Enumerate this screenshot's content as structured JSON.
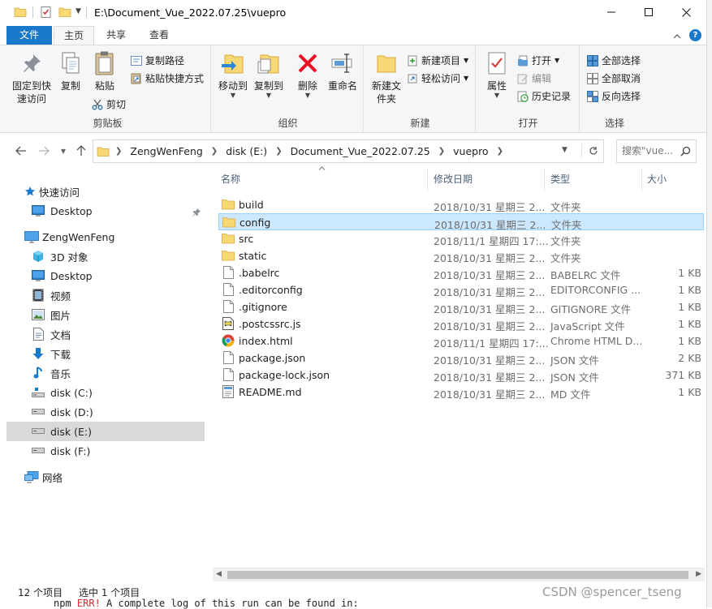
{
  "window": {
    "title": "E:\\Document_Vue_2022.07.25\\vuepro"
  },
  "tabs": [
    {
      "label": "文件"
    },
    {
      "label": "主页"
    },
    {
      "label": "共享"
    },
    {
      "label": "查看"
    }
  ],
  "ribbon": {
    "clipboard": {
      "pin_label": "固定到快速访问",
      "copy_label": "复制",
      "paste_label": "粘贴",
      "copy_path_label": "复制路径",
      "paste_shortcut_label": "粘贴快捷方式",
      "cut_label": "剪切",
      "group_label": "剪贴板"
    },
    "organize": {
      "move_to_label": "移动到",
      "copy_to_label": "复制到",
      "delete_label": "删除",
      "rename_label": "重命名",
      "group_label": "组织"
    },
    "new": {
      "new_folder_label": "新建文件夹",
      "new_item_label": "新建项目",
      "easy_access_label": "轻松访问",
      "group_label": "新建"
    },
    "open": {
      "properties_label": "属性",
      "open_label": "打开",
      "edit_label": "编辑",
      "history_label": "历史记录",
      "group_label": "打开"
    },
    "select": {
      "select_all_label": "全部选择",
      "select_none_label": "全部取消",
      "invert_label": "反向选择",
      "group_label": "选择"
    }
  },
  "address": {
    "crumbs": [
      "ZengWenFeng",
      "disk (E:)",
      "Document_Vue_2022.07.25",
      "vuepro"
    ],
    "search_placeholder": "搜索\"vue..."
  },
  "nav": {
    "quick_access": "快速访问",
    "desktop_pinned": "Desktop",
    "this_pc": "ZengWenFeng",
    "objects_3d": "3D 对象",
    "desktop": "Desktop",
    "videos": "视频",
    "pictures": "图片",
    "documents": "文档",
    "downloads": "下载",
    "music": "音乐",
    "disk_c": "disk (C:)",
    "disk_d": "disk (D:)",
    "disk_e": "disk (E:)",
    "disk_f": "disk (F:)",
    "network": "网络"
  },
  "columns": {
    "name": "名称",
    "date": "修改日期",
    "type": "类型",
    "size": "大小"
  },
  "files": [
    {
      "name": "build",
      "date": "2018/10/31 星期三 2...",
      "type": "文件夹",
      "size": "",
      "icon": "folder"
    },
    {
      "name": "config",
      "date": "2018/10/31 星期三 2...",
      "type": "文件夹",
      "size": "",
      "icon": "folder"
    },
    {
      "name": "src",
      "date": "2018/11/1 星期四 17:...",
      "type": "文件夹",
      "size": "",
      "icon": "folder"
    },
    {
      "name": "static",
      "date": "2018/10/31 星期三 2...",
      "type": "文件夹",
      "size": "",
      "icon": "folder"
    },
    {
      "name": ".babelrc",
      "date": "2018/10/31 星期三 2...",
      "type": "BABELRC 文件",
      "size": "1 KB",
      "icon": "file"
    },
    {
      "name": ".editorconfig",
      "date": "2018/10/31 星期三 2...",
      "type": "EDITORCONFIG ...",
      "size": "1 KB",
      "icon": "file"
    },
    {
      "name": ".gitignore",
      "date": "2018/10/31 星期三 2...",
      "type": "GITIGNORE 文件",
      "size": "1 KB",
      "icon": "file"
    },
    {
      "name": ".postcssrc.js",
      "date": "2018/10/31 星期三 2...",
      "type": "JavaScript 文件",
      "size": "1 KB",
      "icon": "js"
    },
    {
      "name": "index.html",
      "date": "2018/11/1 星期四 17:...",
      "type": "Chrome HTML D...",
      "size": "1 KB",
      "icon": "chrome"
    },
    {
      "name": "package.json",
      "date": "2018/10/31 星期三 2...",
      "type": "JSON 文件",
      "size": "2 KB",
      "icon": "file"
    },
    {
      "name": "package-lock.json",
      "date": "2018/10/31 星期三 2...",
      "type": "JSON 文件",
      "size": "371 KB",
      "icon": "file"
    },
    {
      "name": "README.md",
      "date": "2018/10/31 星期三 2...",
      "type": "MD 文件",
      "size": "1 KB",
      "icon": "md"
    }
  ],
  "selected_file": "config",
  "status": {
    "count": "12 个项目",
    "selection": "选中 1 个项目"
  },
  "watermark": "CSDN @spencer_tseng",
  "console": {
    "prefix": "npm ",
    "err": "ERR!",
    "text": " A complete log of this run can be found in:"
  },
  "colors": {
    "accent": "#1979ca",
    "folder": "#f8d775",
    "selection": "#cce8ff",
    "delete_red": "#e81123"
  }
}
